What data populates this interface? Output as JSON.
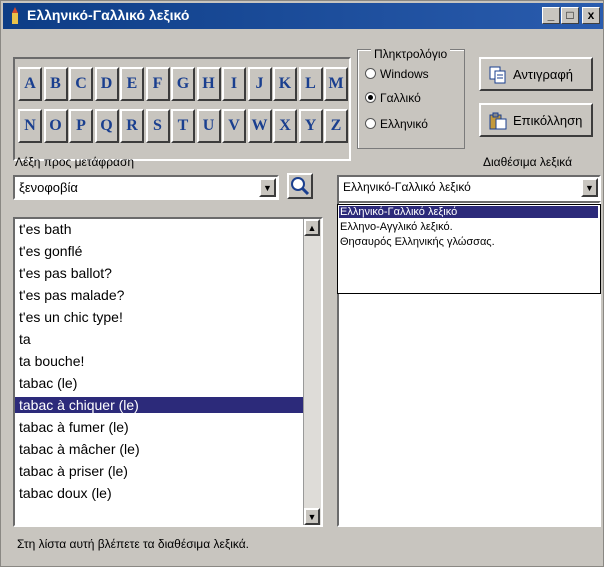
{
  "window": {
    "title": "Ελληνικό-Γαλλικό λεξικό",
    "controls": {
      "minimize": "_",
      "maximize": "□",
      "close": "x"
    }
  },
  "letters_row1": [
    "A",
    "B",
    "C",
    "D",
    "E",
    "F",
    "G",
    "H",
    "I",
    "J",
    "K",
    "L",
    "M"
  ],
  "letters_row2": [
    "N",
    "O",
    "P",
    "Q",
    "R",
    "S",
    "T",
    "U",
    "V",
    "W",
    "X",
    "Y",
    "Z"
  ],
  "keyboard": {
    "title": "Πληκτρολόγιο",
    "options": [
      "Windows",
      "Γαλλικό",
      "Ελληνικό"
    ],
    "selected": "Γαλλικό"
  },
  "buttons": {
    "copy": "Αντιγραφή",
    "paste": "Επικόλληση"
  },
  "labels": {
    "word_to_translate": "Λέξη προς μετάφραση",
    "available_dictionaries": "Διαθέσιμα λεξικά"
  },
  "search": {
    "value": "ξενοφοβία"
  },
  "dictionary_select": {
    "value": "Ελληνικό-Γαλλικό λεξικό",
    "options": [
      "Ελληνικό-Γαλλικό λεξικό",
      "Ελληνο-Αγγλικό λεξικό.",
      "Θησαυρός Ελληνικής γλώσσας."
    ],
    "highlighted": "Ελληνικό-Γαλλικό λεξικό"
  },
  "word_list": {
    "items": [
      "t'es bath",
      "t'es gonflé",
      "t'es pas ballot?",
      "t'es pas malade?",
      "t'es un chic type!",
      "ta",
      "ta bouche!",
      "tabac (le)",
      "tabac à chiquer (le)",
      "tabac à fumer (le)",
      "tabac à mâcher (le)",
      "tabac à priser (le)",
      "tabac doux (le)"
    ],
    "selected": "tabac à chiquer (le)"
  },
  "status": "Στη λίστα αυτή βλέπετε τα διαθέσιμα λεξικά.",
  "colors": {
    "title_bar": "#0d3d86",
    "selection": "#2c2a7a",
    "letter_text": "#1a3f8f"
  }
}
